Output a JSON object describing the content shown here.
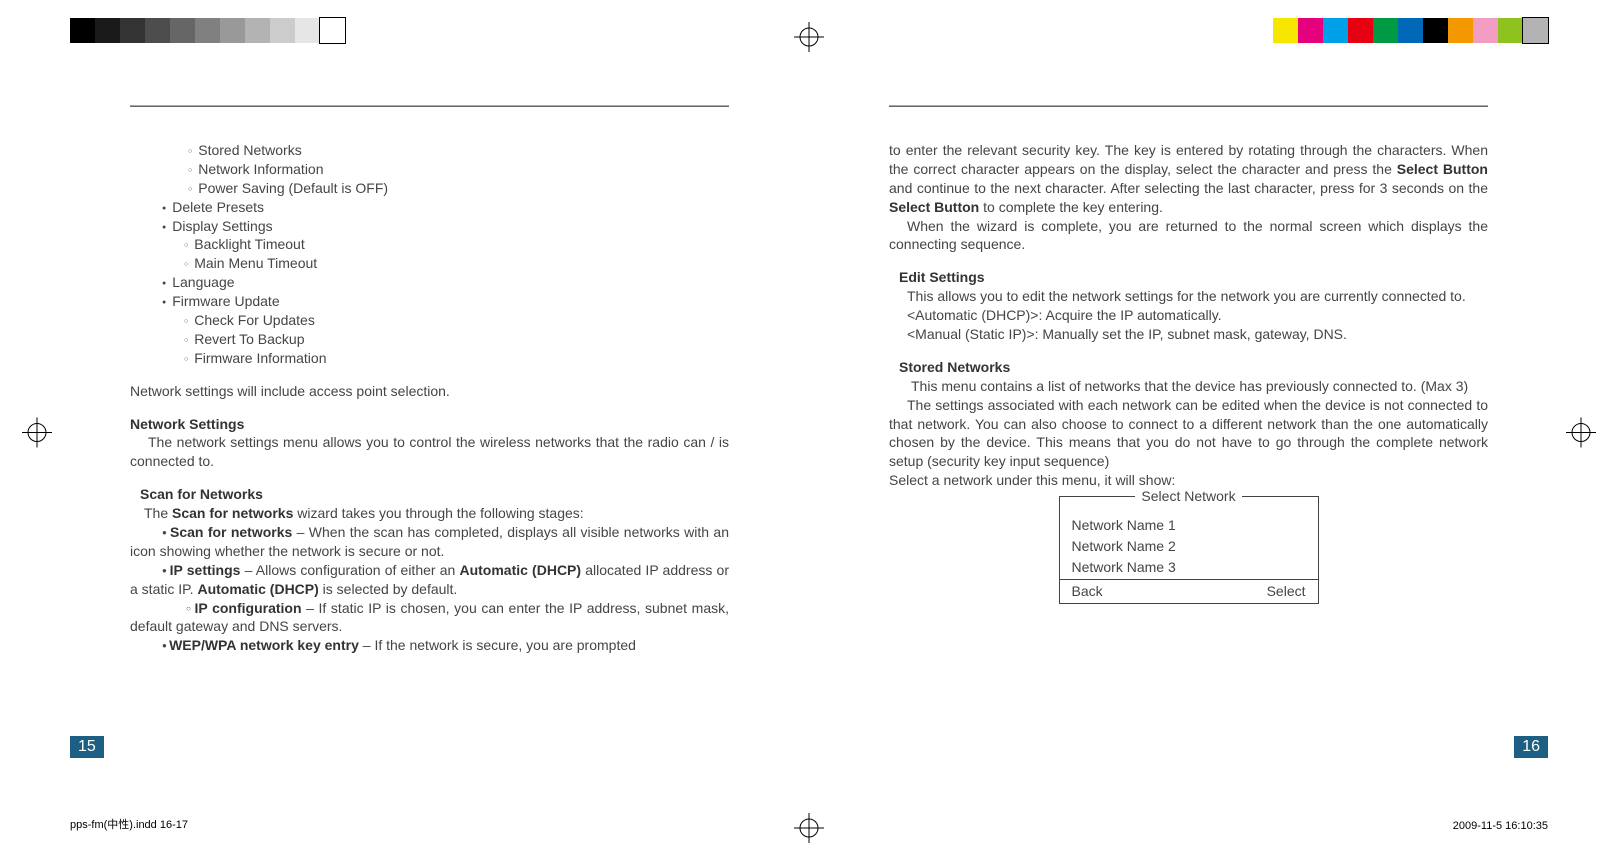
{
  "reg_colors_left": [
    "#000",
    "#1a1a1a",
    "#333",
    "#4d4d4d",
    "#666",
    "#808080",
    "#999",
    "#b3b3b3",
    "#ccc",
    "#e6e6e6",
    "#fff"
  ],
  "reg_colors_right": [
    "#f7e600",
    "#e5007e",
    "#00a0e9",
    "#e60012",
    "#009944",
    "#0068b7",
    "#000000",
    "#f39800",
    "#f19ec2",
    "#8ec31f",
    "#b3b3b3"
  ],
  "left": {
    "bullets_l1a": [
      "Stored Networks",
      "Network Information",
      "Power Saving (Default is OFF)"
    ],
    "bullets_l1b": [
      "Delete Presets",
      "Display Settings"
    ],
    "bullets_l1b_sub": [
      "Backlight Timeout",
      "Main Menu Timeout"
    ],
    "bullets_l1c": [
      "Language",
      "Firmware Update"
    ],
    "bullets_l1c_sub": [
      "Check For Updates",
      "Revert To Backup",
      "Firmware Information"
    ],
    "p1": "Network settings will include access point selection.",
    "h1": "Network Settings",
    "p2": "The network settings menu allows you to control the wireless networks that the radio can / is connected to.",
    "h2": "Scan for Networks",
    "p3_pre": "The ",
    "p3_b": "Scan for networks",
    "p3_post": " wizard takes you through the following stages:",
    "li1_b": "Scan for networks",
    "li1_t": " – When the scan has completed, displays all visible networks with an icon showing whether the network is secure or not.",
    "li2_b": "IP settings",
    "li2_t": " – Allows configuration of either an ",
    "li2_b2": "Automatic (DHCP)",
    "li2_t2": " allocated IP address or a static IP. ",
    "li2_b3": "Automatic (DHCP)",
    "li2_t3": " is selected by default.",
    "li3_b": "IP configuration",
    "li3_t": " – If static IP is chosen, you can enter the IP address, subnet mask, default gateway and DNS servers.",
    "li4_b": "WEP/WPA network key entry",
    "li4_t": " – If the network is secure, you are prompted",
    "page_no": "15"
  },
  "right": {
    "p1a": "to enter the relevant security key. The key is entered by rotating through the characters. When the correct character appears on the display, select the character and press the ",
    "p1b": "Select Button",
    "p1c": " and continue to the next character. After selecting the last character, press for 3 seconds on the ",
    "p1d": "Select Button",
    "p1e": " to complete the key entering.",
    "p2": "When the wizard is complete, you are returned to the normal screen which displays the connecting sequence.",
    "h1": "Edit Settings",
    "p3": "This allows you to edit the network settings for the network you are currently connected to.",
    "p4": "<Automatic (DHCP)>: Acquire the IP automatically.",
    "p5": "<Manual (Static IP)>: Manually set the IP, subnet mask, gateway, DNS.",
    "h2": "Stored Networks",
    "p6": "This menu contains a list of networks that the device has previously connected to. (Max 3)",
    "p7": "The settings associated with each network can be edited when the device is not connected to that network. You can also choose to connect to a different network than the one automatically chosen by the device. This means that you do not have to go through the complete network setup (security key input sequence)",
    "p8": "Select a network under this menu, it will show:",
    "box": {
      "title": "Select Network",
      "rows": [
        "Network Name 1",
        "Network Name 2",
        "Network Name 3"
      ],
      "back": "Back",
      "select": "Select"
    },
    "page_no": "16"
  },
  "footer_left": "pps-fm(中性).indd   16-17",
  "footer_right": "2009-11-5   16:10:35"
}
